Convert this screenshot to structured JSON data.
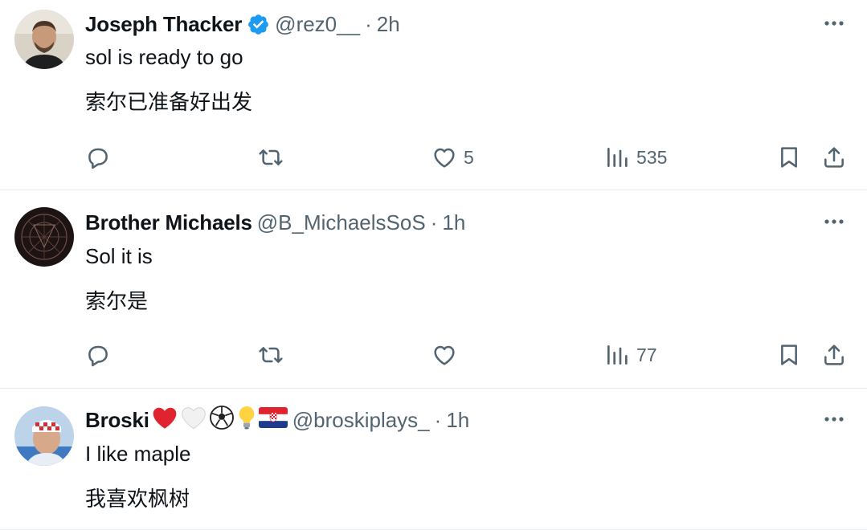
{
  "tweets": [
    {
      "name": "Joseph Thacker",
      "verified": true,
      "handle": "@rez0__",
      "separator": "·",
      "time": "2h",
      "text_en": "sol is ready to go",
      "text_zh": "索尔已准备好出发",
      "replies": "",
      "retweets": "",
      "likes": "5",
      "views": "535"
    },
    {
      "name": "Brother Michaels",
      "verified": false,
      "handle": "@B_MichaelsSoS",
      "separator": "·",
      "time": "1h",
      "text_en": "Sol it is",
      "text_zh": "索尔是",
      "replies": "",
      "retweets": "",
      "likes": "",
      "views": "77"
    },
    {
      "name": "Broski",
      "name_emojis": [
        "red-heart",
        "white-heart",
        "soccer-ball",
        "light-bulb",
        "croatia-flag"
      ],
      "verified": false,
      "handle": "@broskiplays_",
      "separator": "·",
      "time": "1h",
      "text_en": "I like maple",
      "text_zh": "我喜欢枫树"
    }
  ],
  "colors": {
    "text": "#0f1419",
    "secondary": "#536471",
    "verified": "#1d9bf0",
    "divider": "#e6ecf0"
  }
}
